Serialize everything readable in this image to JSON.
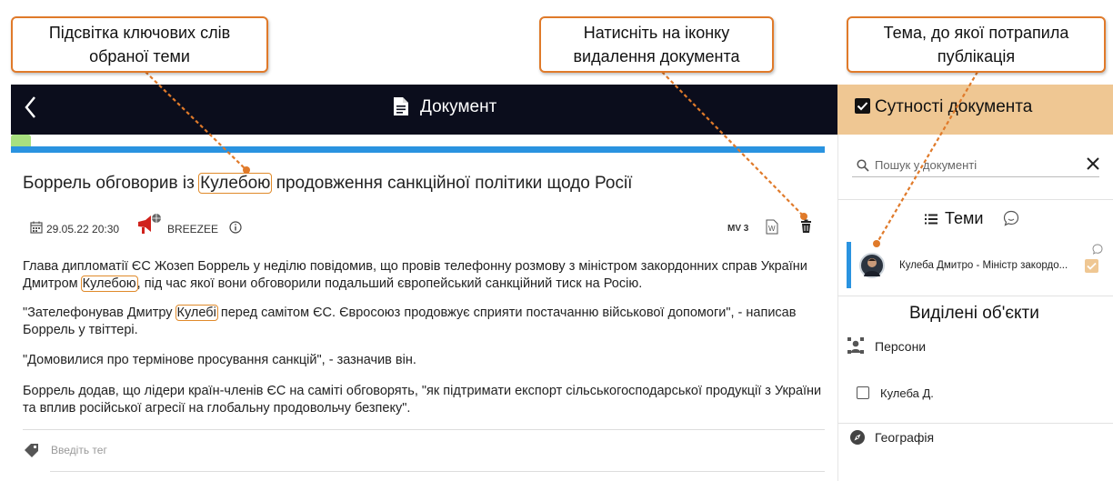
{
  "annotations": {
    "keywords": "Підсвітка ключових слів обраної теми",
    "delete": "Натисніть на іконку видалення документа",
    "topic": "Тема, до якої потрапила публікація"
  },
  "header": {
    "back_icon": "chevron-left-icon",
    "title": "Документ",
    "entities_title": "Сутності документа"
  },
  "article": {
    "title_before": "Боррель обговорив із ",
    "title_keyword": "Кулебою",
    "title_after": " продовження санкційної політики щодо Росії",
    "date": "29.05.22 20:30",
    "source": "BREEZEE",
    "mv": "MV 3",
    "p1_before": "Глава дипломатії ЄС Жозеп Боррель у неділю повідомив, що провів телефонну розмову з міністром закордонних справ України Дмитром ",
    "p1_keyword": "Кулебою",
    "p1_after": ", під час якої вони обговорили подальший європейський санкційний тиск на Росію.",
    "p2_before": "\"Зателефонував Дмитру ",
    "p2_keyword": "Кулебі",
    "p2_after": " перед самітом ЄС. Євросоюз продовжує сприяти постачанню військової допомоги\", - написав Боррель у твіттері.",
    "p3": "\"Домовилися про термінове просування санкцій\", - зазначив він.",
    "p4": "Боррель додав, що лідери країн-членів ЄС на саміті обговорять, \"як підтримати експорт сільськогосподарської продукції з України та вплив російської агресії на глобальну продовольчу безпеку\".",
    "tag_placeholder": "Введіть тег"
  },
  "panel": {
    "search_placeholder": "Пошук у документі",
    "topics_label": "Теми",
    "topic_item": "Кулеба Дмитро - Міністр закордо...",
    "selected_objects": "Виділені об'єкти",
    "persons": "Персони",
    "person_item": "Кулеба Д.",
    "geography": "Географія"
  },
  "colors": {
    "header_dark": "#0b0d1c",
    "header_tan": "#efc793",
    "accent_blue": "#2a93e0",
    "annotation_orange": "#e07a2a"
  }
}
